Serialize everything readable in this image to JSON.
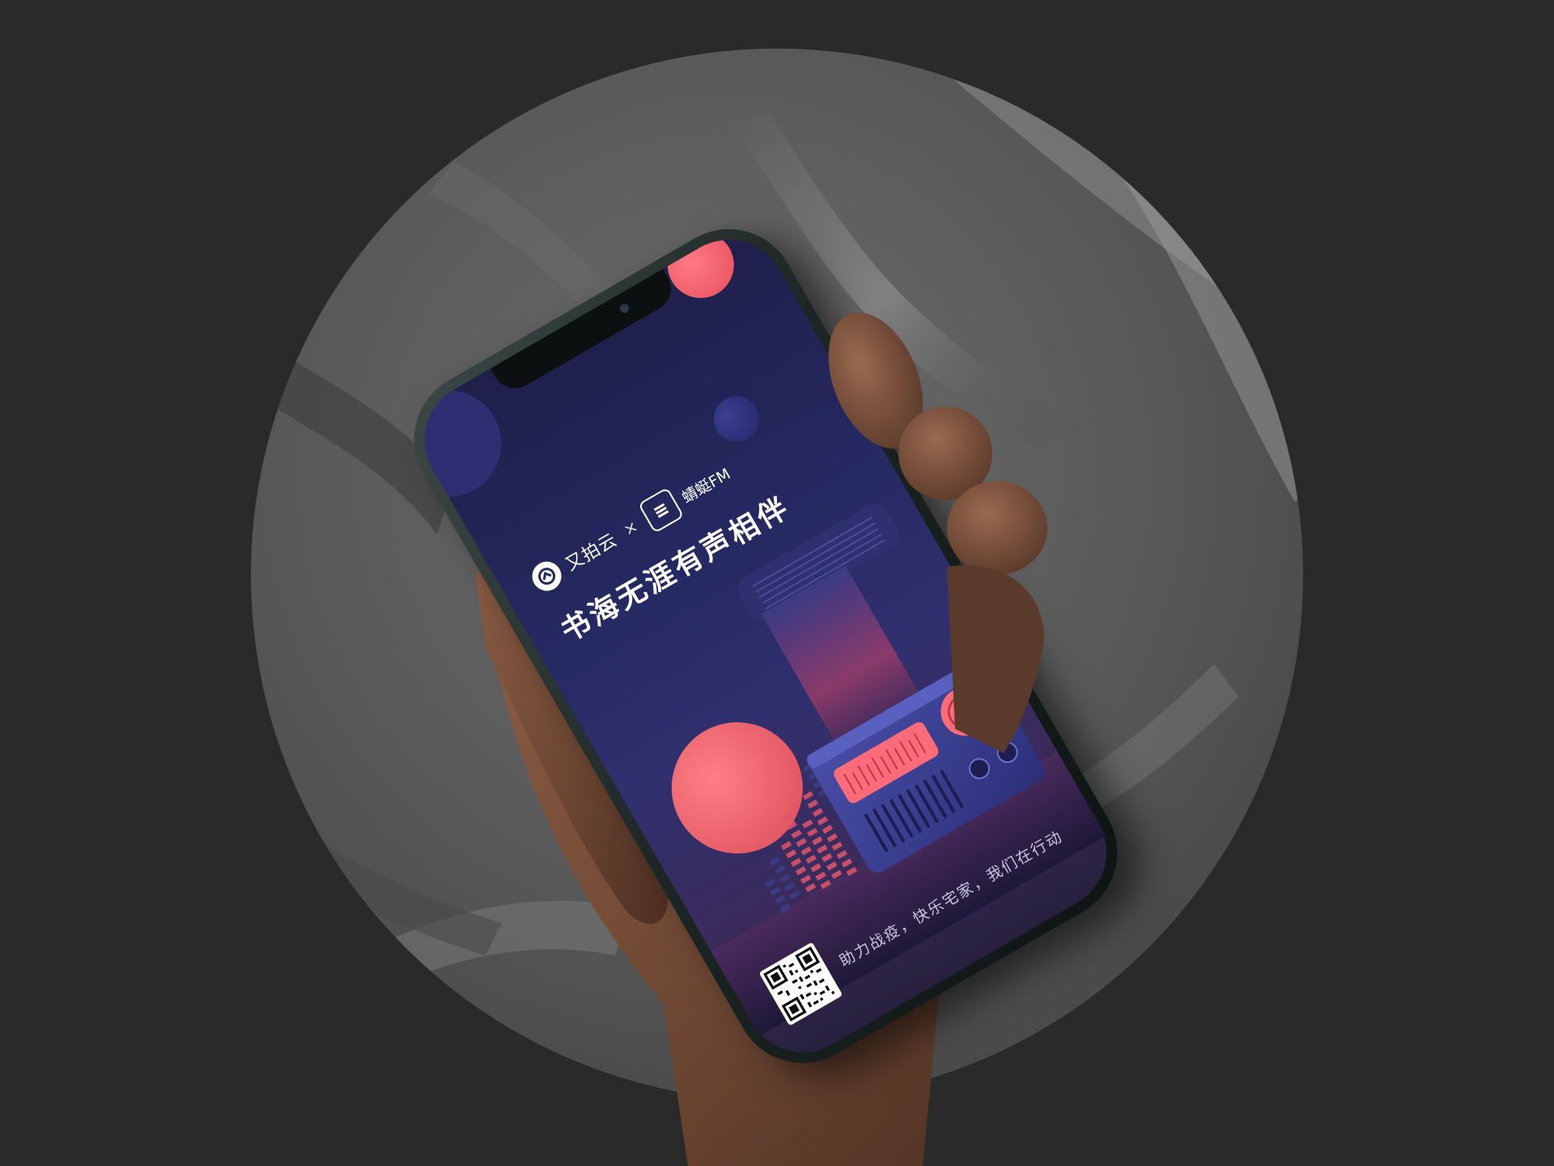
{
  "scene": {
    "background_color": "#2a2a2a",
    "disc_color": "#5a5a5a",
    "hand_color": "#6d4733"
  },
  "poster": {
    "brand_left": "又拍云",
    "brand_separator": "×",
    "brand_right": "蜻蜓FM",
    "headline": "书海无涯有声相伴",
    "slogan": "助力战疫，快乐宅家，我们在行动",
    "accent_color": "#ff6b78",
    "screen_color": "#262a63"
  }
}
